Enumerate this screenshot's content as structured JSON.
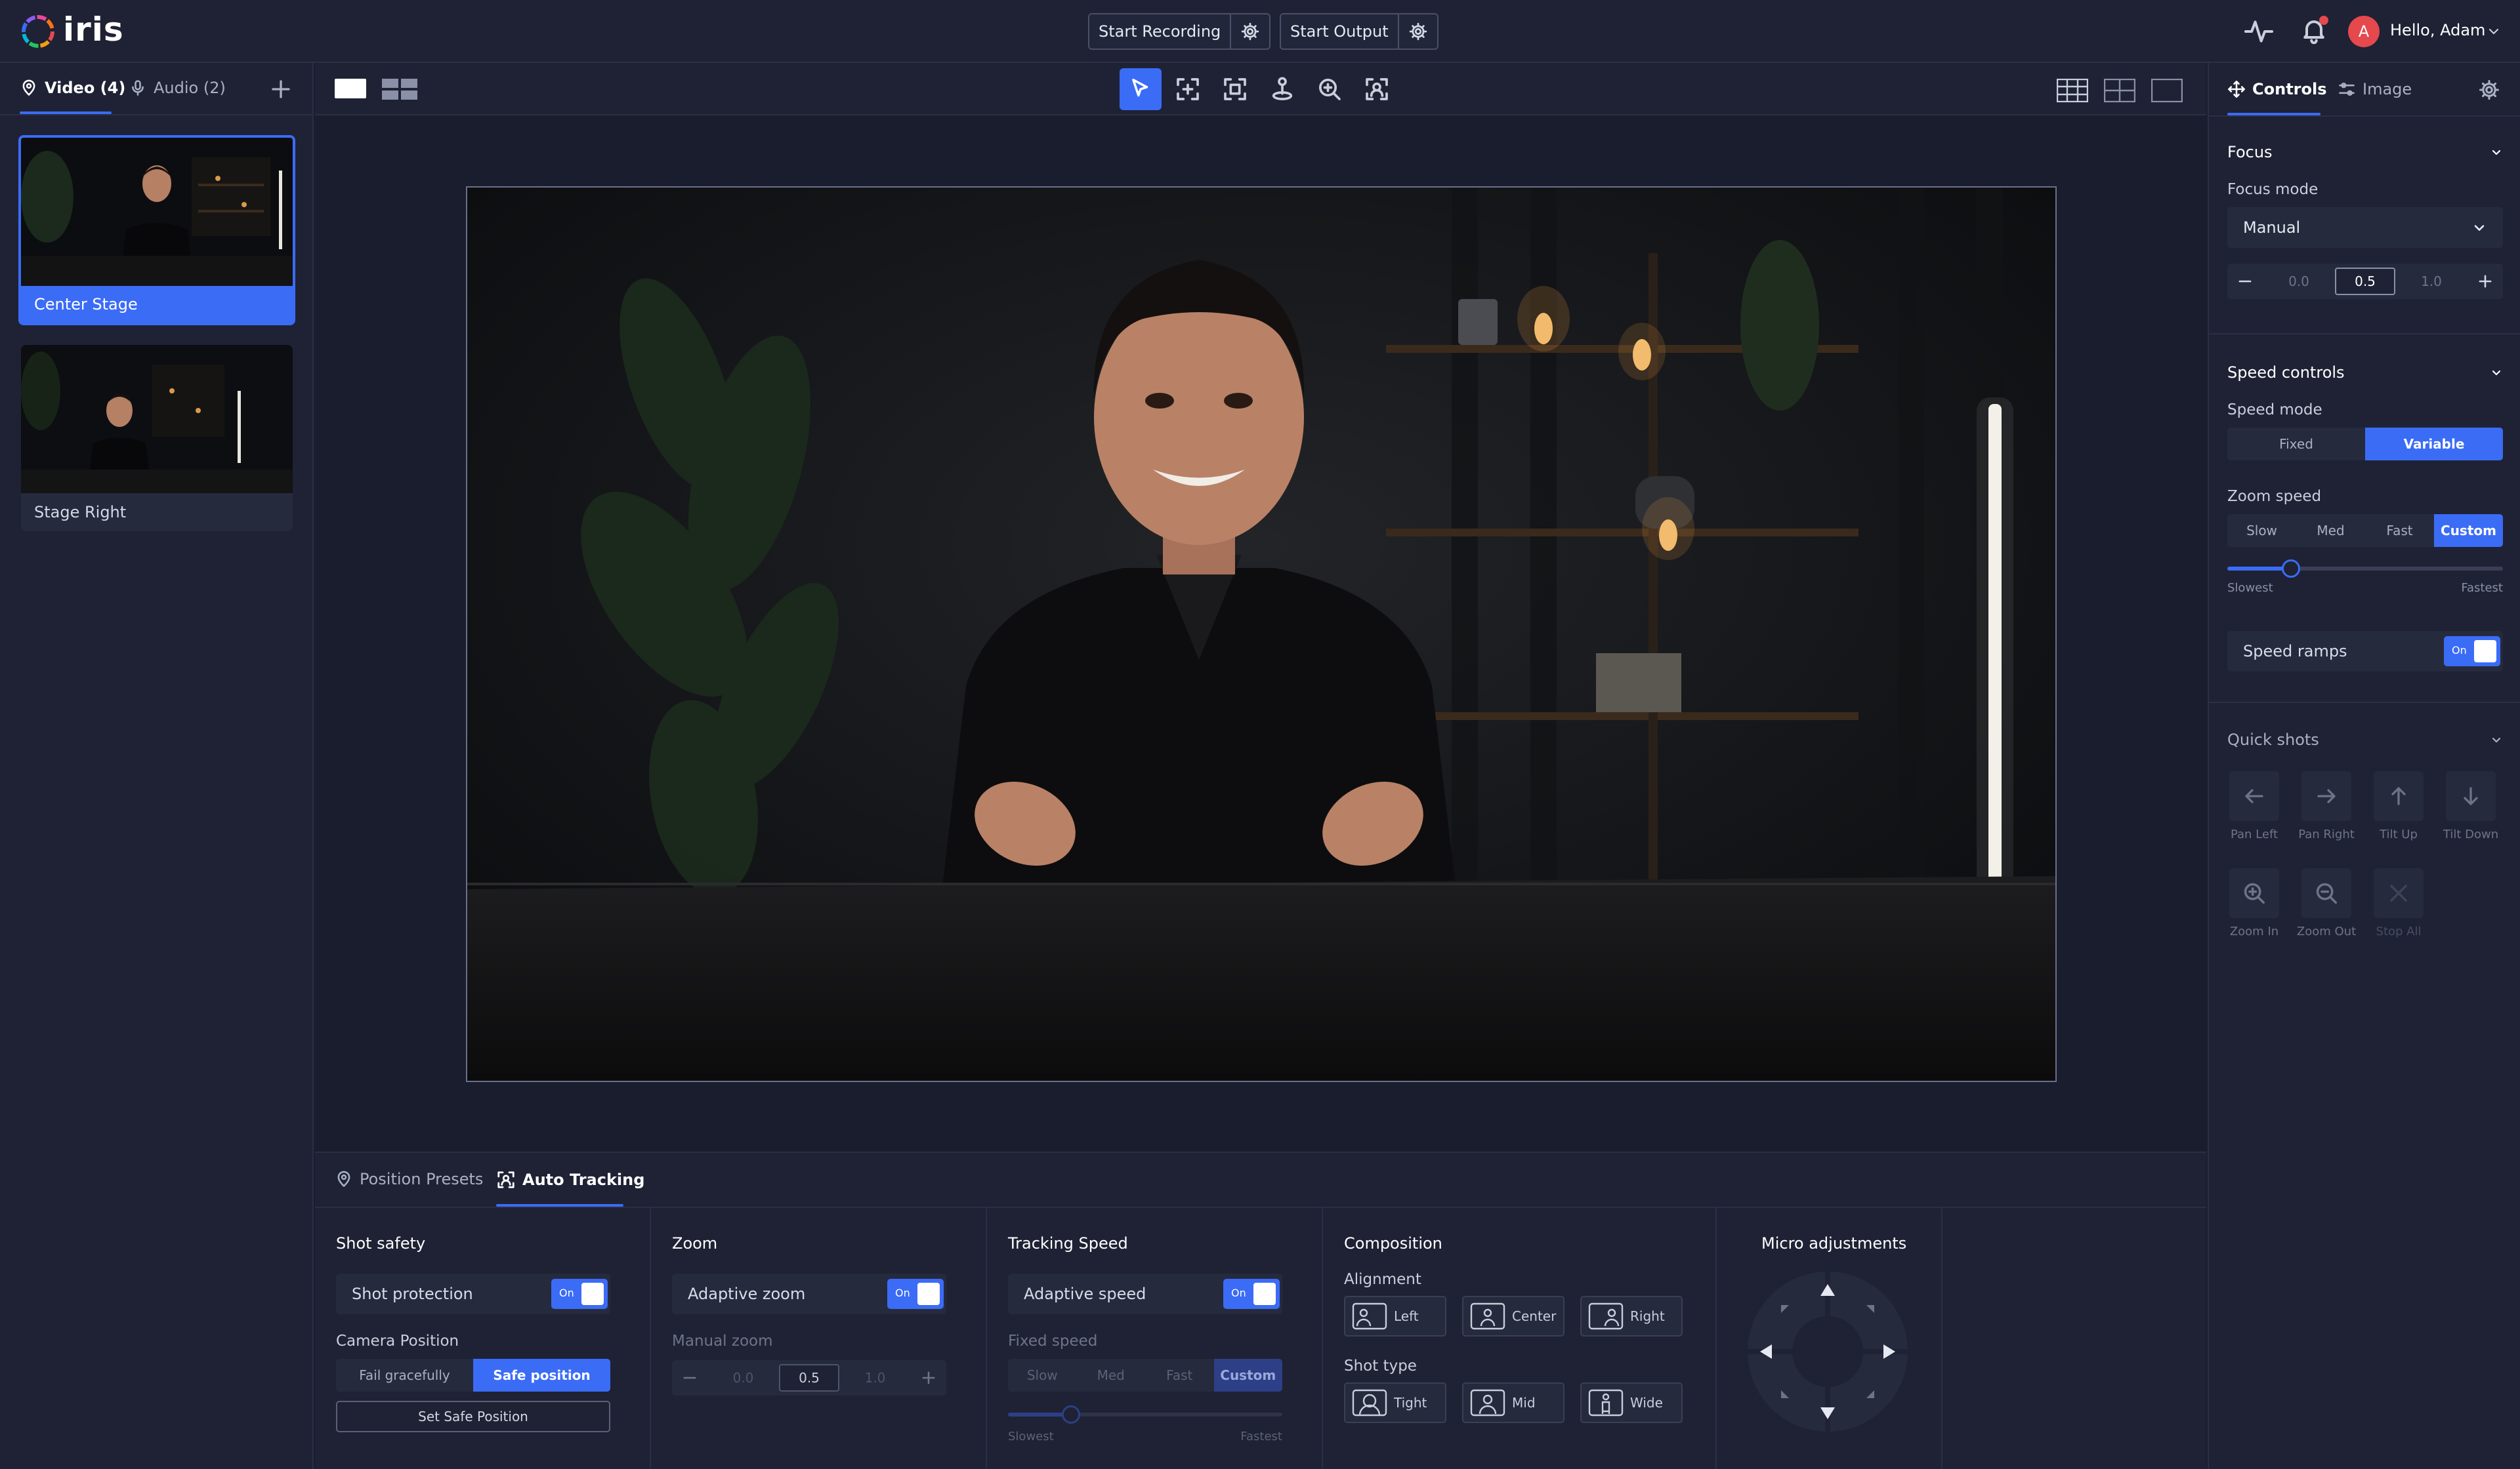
{
  "app": {
    "name": "iris"
  },
  "header": {
    "start_recording": "Start Recording",
    "start_output": "Start Output",
    "greeting": "Hello, Adam",
    "avatar_initial": "A"
  },
  "sources": {
    "tabs": [
      {
        "label": "Video (4)",
        "active": true
      },
      {
        "label": "Audio (2)",
        "active": false
      }
    ],
    "cameras": [
      {
        "label": "Center Stage",
        "selected": true
      },
      {
        "label": "Stage Right",
        "selected": false
      }
    ]
  },
  "bottom": {
    "tabs": [
      {
        "label": "Position Presets",
        "active": false
      },
      {
        "label": "Auto Tracking",
        "active": true
      }
    ],
    "shot_safety": {
      "title": "Shot safety",
      "toggle_label": "Shot protection",
      "toggle_state": "On",
      "camera_position_label": "Camera Position",
      "options": [
        "Fail gracefully",
        "Safe position"
      ],
      "selected": "Safe position",
      "set_button": "Set Safe Position"
    },
    "zoom": {
      "title": "Zoom",
      "toggle_label": "Adaptive zoom",
      "toggle_state": "On",
      "manual_label": "Manual zoom",
      "min": "0.0",
      "value": "0.5",
      "max": "1.0"
    },
    "tracking_speed": {
      "title": "Tracking Speed",
      "toggle_label": "Adaptive speed",
      "toggle_state": "On",
      "fixed_label": "Fixed speed",
      "options": [
        "Slow",
        "Med",
        "Fast",
        "Custom"
      ],
      "selected": "Custom",
      "slider_min_label": "Slowest",
      "slider_max_label": "Fastest",
      "slider_value": 0.23
    },
    "composition": {
      "title": "Composition",
      "alignment_label": "Alignment",
      "alignment": [
        "Left",
        "Center",
        "Right"
      ],
      "shot_type_label": "Shot type",
      "shot_types": [
        "Tight",
        "Mid",
        "Wide"
      ]
    },
    "micro": {
      "title": "Micro adjustments"
    }
  },
  "right": {
    "tabs": [
      {
        "label": "Controls",
        "active": true
      },
      {
        "label": "Image",
        "active": false
      }
    ],
    "focus": {
      "title": "Focus",
      "mode_label": "Focus mode",
      "mode_value": "Manual",
      "min": "0.0",
      "value": "0.5",
      "max": "1.0"
    },
    "speed": {
      "title": "Speed controls",
      "mode_label": "Speed mode",
      "mode_options": [
        "Fixed",
        "Variable"
      ],
      "mode_selected": "Variable",
      "zoom_speed_label": "Zoom speed",
      "zoom_options": [
        "Slow",
        "Med",
        "Fast",
        "Custom"
      ],
      "zoom_selected": "Custom",
      "slider_min_label": "Slowest",
      "slider_max_label": "Fastest",
      "slider_value": 0.23,
      "ramps_label": "Speed ramps",
      "ramps_state": "On"
    },
    "quick_shots": {
      "title": "Quick shots",
      "items": [
        {
          "label": "Pan Left",
          "icon": "arrow-left-icon"
        },
        {
          "label": "Pan Right",
          "icon": "arrow-right-icon"
        },
        {
          "label": "Tilt Up",
          "icon": "arrow-up-icon"
        },
        {
          "label": "Tilt Down",
          "icon": "arrow-down-icon"
        },
        {
          "label": "Zoom In",
          "icon": "zoom-in-icon"
        },
        {
          "label": "Zoom Out",
          "icon": "zoom-out-icon"
        },
        {
          "label": "Stop All",
          "icon": "close-icon"
        }
      ]
    }
  },
  "colors": {
    "accent": "#3b6cf6",
    "background": "#191d2e",
    "panel": "#1e2234",
    "avatar": "#e5484d",
    "notification_dot": "#e5484d"
  }
}
